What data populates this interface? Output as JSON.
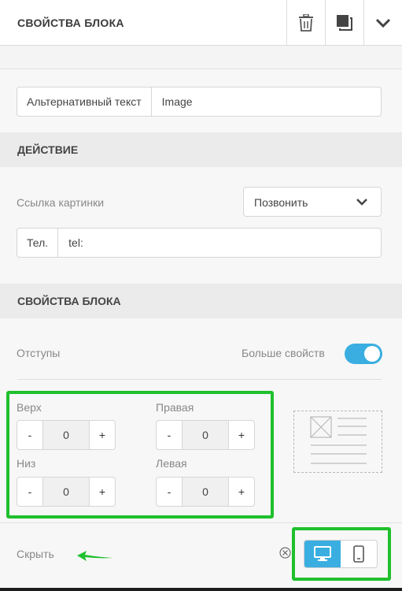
{
  "header": {
    "title": "СВОЙСТВА БЛОКА",
    "buttons": [
      {
        "icon": "trash-icon"
      },
      {
        "icon": "copy-icon"
      },
      {
        "icon": "chevron-down-icon"
      }
    ]
  },
  "image_settings": {
    "alt_label": "Альтернативный текст",
    "alt_value": "Image"
  },
  "action_section": {
    "title": "ДЕЙСТВИЕ",
    "link_label": "Ссылка картинки",
    "link_select_value": "Позвонить",
    "phone_label": "Тел.",
    "phone_value": "tel:"
  },
  "block_section": {
    "title": "СВОЙСТВА БЛОКА",
    "padding_label": "Отступы",
    "more_props_label": "Больше свойств",
    "more_props_enabled": true,
    "paddings": {
      "top": {
        "label": "Верх",
        "value": "0"
      },
      "right": {
        "label": "Правая",
        "value": "0"
      },
      "bottom": {
        "label": "Низ",
        "value": "0"
      },
      "left": {
        "label": "Левая",
        "value": "0"
      }
    },
    "minus": "-",
    "plus": "+"
  },
  "footer": {
    "hide_label": "Скрыть",
    "devices": [
      {
        "icon": "desktop-icon",
        "active": true
      },
      {
        "icon": "mobile-icon",
        "active": false
      }
    ]
  },
  "colors": {
    "accent": "#3aaee0",
    "highlight": "#1fc02d"
  }
}
